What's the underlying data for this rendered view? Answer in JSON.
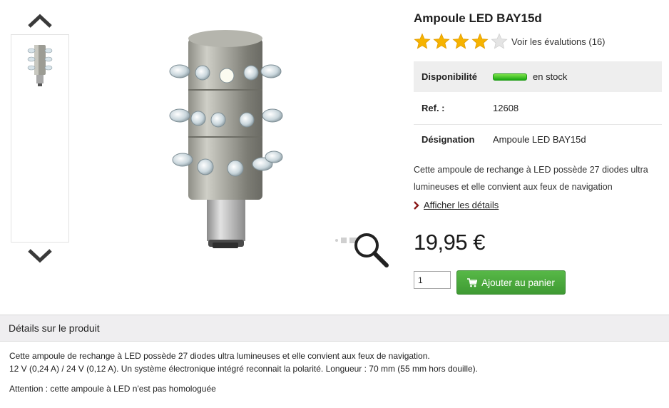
{
  "product": {
    "title": "Ampoule LED BAY15d",
    "rating": 4,
    "rating_max": 5,
    "reviews_link": "Voir les évalutions (16)",
    "short_description": "Cette ampoule de rechange à LED possède 27 diodes ultra lumineuses et elle convient aux feux de navigation",
    "details_link": "Afficher les détails",
    "price": "19,95 €"
  },
  "info_table": [
    {
      "key": "Disponibilité",
      "value": "en stock"
    },
    {
      "key": "Ref. :",
      "value": "12608"
    },
    {
      "key": "Désignation",
      "value": "Ampoule LED BAY15d"
    }
  ],
  "cart": {
    "quantity": "1",
    "add_label": "Ajouter au panier"
  },
  "details_section": {
    "header": "Détails sur le produit",
    "line1": "Cette ampoule de rechange à LED possède 27 diodes ultra lumineuses et elle convient aux feux de navigation.",
    "line2": "12 V (0,24 A) / 24 V (0,12 A). Un système électronique intégré reconnait la polarité. Longueur : 70 mm (55 mm hors douille).",
    "line3": "Attention : cette ampoule à LED n'est pas homologuée"
  },
  "colors": {
    "stock_green": "#1aa812",
    "cart_button": "#4aa93c",
    "star_gold": "#f6b300",
    "star_empty": "#dddddd",
    "header_bg": "#efeef0"
  },
  "icons": {
    "scroll_up": "chevron-up-icon",
    "scroll_down": "chevron-down-icon",
    "zoom": "magnifier-icon",
    "details": "chevron-right-icon",
    "cart": "shopping-cart-icon",
    "star": "star-icon"
  }
}
